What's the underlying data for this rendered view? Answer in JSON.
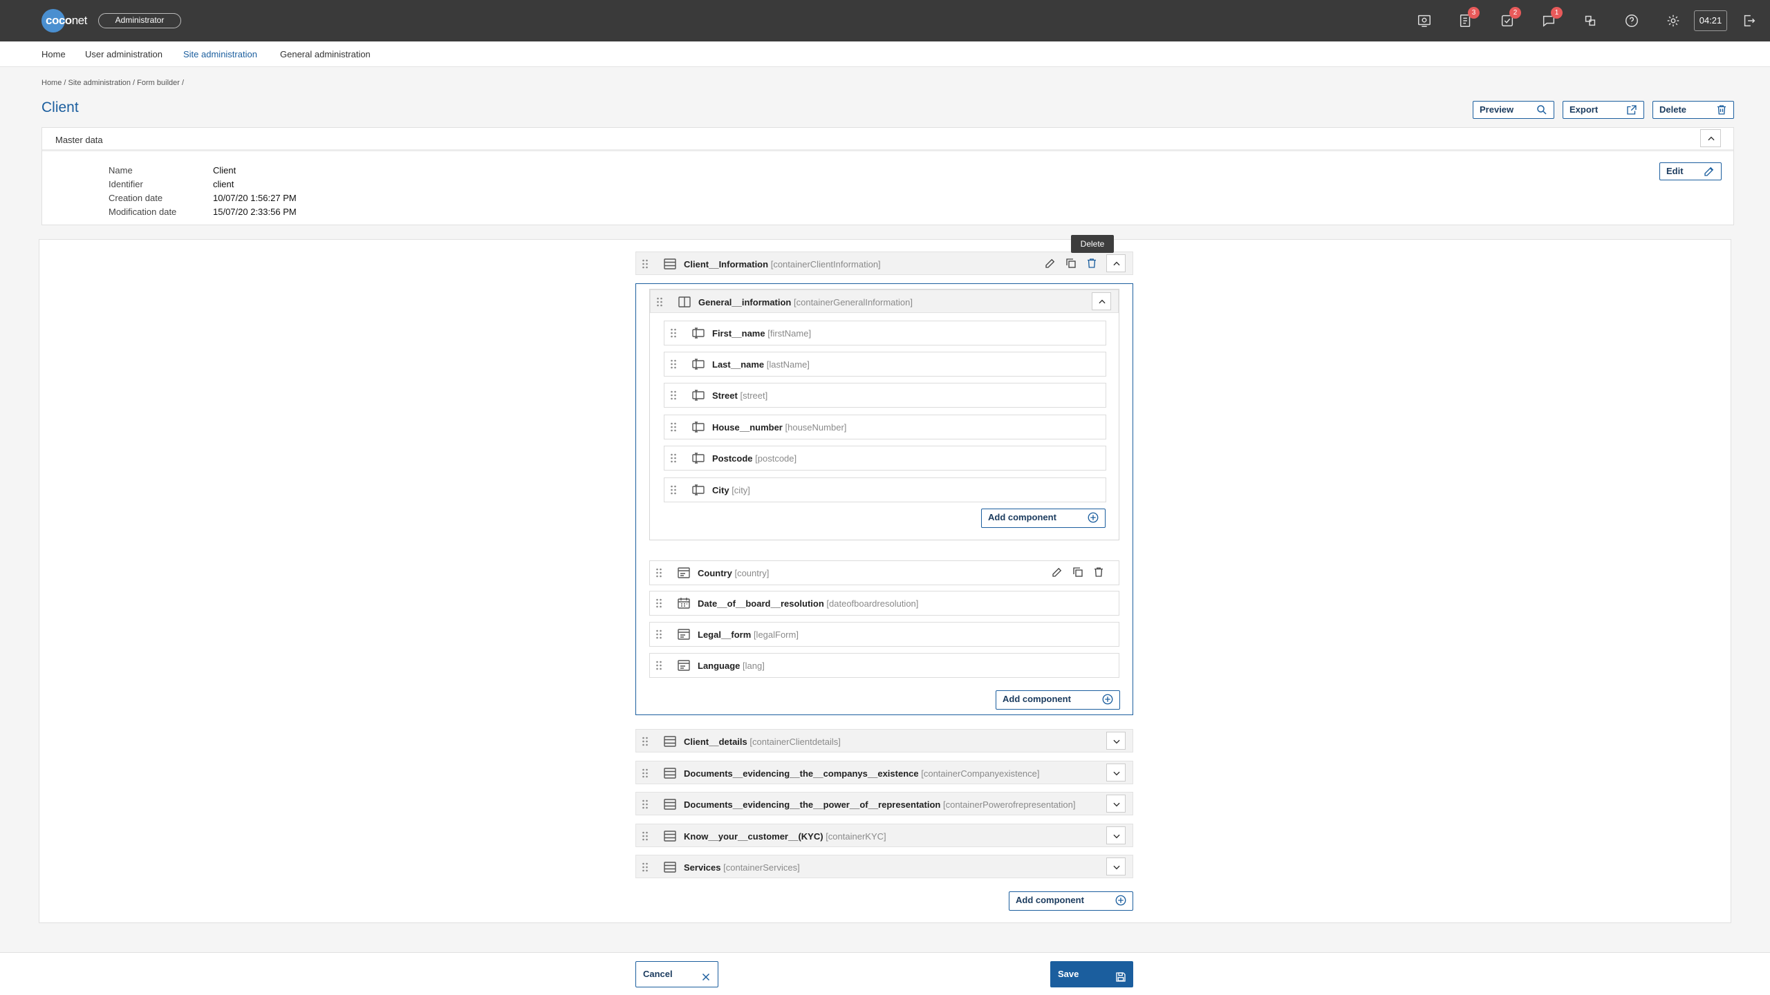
{
  "app": {
    "logo_main": "coco",
    "logo_accent": "net",
    "role": "Administrator",
    "clock": "04:21",
    "badges": {
      "documents": "3",
      "tasks": "2",
      "messages": "1"
    }
  },
  "nav": {
    "items": [
      "Home",
      "User administration",
      "Site administration",
      "General administration"
    ],
    "active_index": 2
  },
  "breadcrumb": "Home /  Site administration / Form builder /",
  "page": {
    "title": "Client",
    "buttons": {
      "preview": "Preview",
      "export": "Export",
      "delete": "Delete"
    }
  },
  "master": {
    "title": "Master data",
    "edit": "Edit",
    "fields": [
      {
        "label": "Name",
        "value": "Client"
      },
      {
        "label": "Identifier",
        "value": "client"
      },
      {
        "label": "Creation date",
        "value": "10/07/20 1:56:27 PM"
      },
      {
        "label": "Modification date",
        "value": "15/07/20 2:33:56 PM"
      }
    ]
  },
  "tooltip": "Delete",
  "builder": {
    "top": {
      "name": "Client__Information",
      "key": "[containerClientInformation]"
    },
    "group": {
      "name": "General__information",
      "key": "[containerGeneralInformation]"
    },
    "group_fields": [
      {
        "name": "First__name",
        "key": "[firstName]"
      },
      {
        "name": "Last__name",
        "key": "[lastName]"
      },
      {
        "name": "Street",
        "key": "[street]"
      },
      {
        "name": "House__number",
        "key": "[houseNumber]"
      },
      {
        "name": "Postcode",
        "key": "[postcode]"
      },
      {
        "name": "City",
        "key": "[city]"
      }
    ],
    "sub_fields": [
      {
        "name": "Country",
        "key": "[country]",
        "icon": "select-icon"
      },
      {
        "name": "Date__of__board__resolution",
        "key": "[dateofboardresolution]",
        "icon": "calendar-icon"
      },
      {
        "name": "Legal__form",
        "key": "[legalForm]",
        "icon": "select-icon"
      },
      {
        "name": "Language",
        "key": "[lang]",
        "icon": "select-icon"
      }
    ],
    "containers": [
      {
        "name": "Client__details",
        "key": "[containerClientdetails]"
      },
      {
        "name": "Documents__evidencing__the__companys__existence",
        "key": "[containerCompanyexistence]"
      },
      {
        "name": "Documents__evidencing__the__power__of__representation",
        "key": "[containerPowerofrepresentation]"
      },
      {
        "name": "Know__your__customer__(KYC)",
        "key": "[containerKYC]"
      },
      {
        "name": "Services",
        "key": "[containerServices]"
      }
    ],
    "add_component": "Add component"
  },
  "footer": {
    "cancel": "Cancel",
    "save": "Save"
  }
}
